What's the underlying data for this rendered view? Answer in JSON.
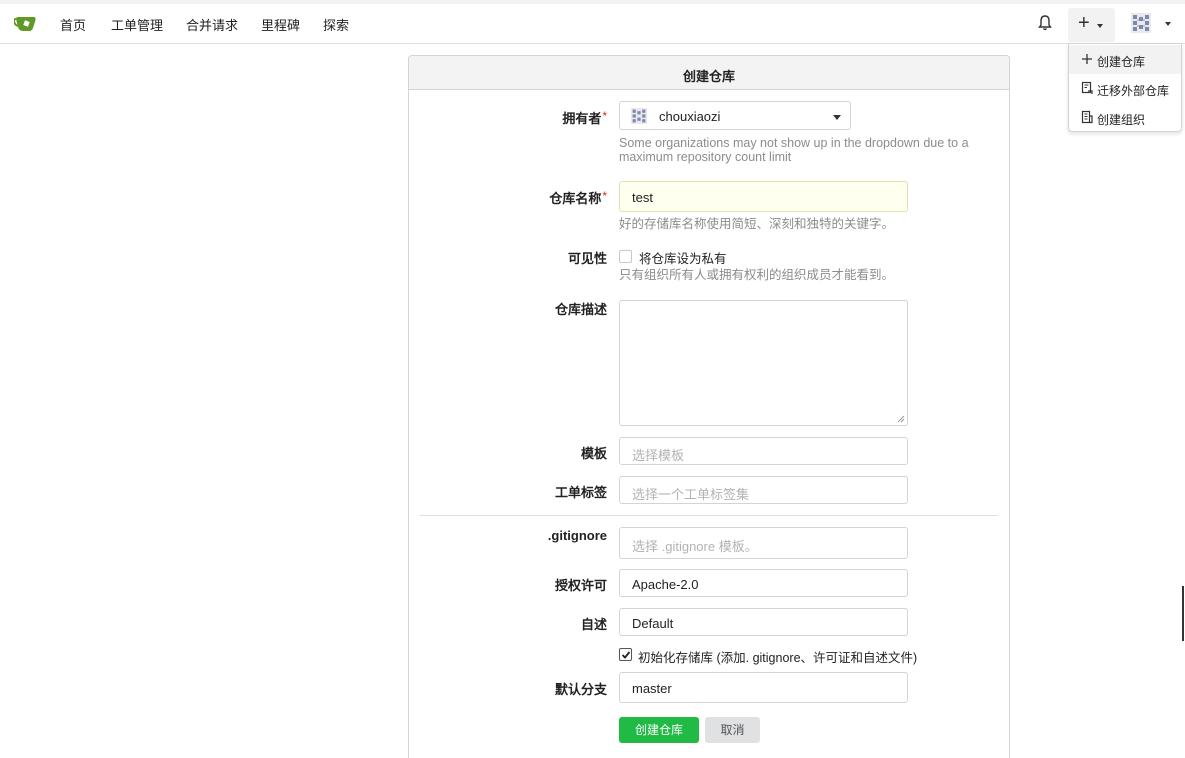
{
  "nav": {
    "items": [
      "首页",
      "工单管理",
      "合并请求",
      "里程碑",
      "探索"
    ],
    "bell_icon": "bell-icon",
    "plus_icon": "plus-icon",
    "avatar_icon": "user-avatar-icon"
  },
  "dropdown": {
    "items": [
      {
        "label": "创建仓库",
        "icon": "plus-icon"
      },
      {
        "label": "迁移外部仓库",
        "icon": "repo-clone-icon"
      },
      {
        "label": "创建组织",
        "icon": "organization-icon"
      }
    ]
  },
  "form": {
    "title": "创建仓库",
    "owner": {
      "label": "拥有者",
      "value": "chouxiaozi",
      "hint": "Some organizations may not show up in the dropdown due to a maximum repository count limit"
    },
    "repo_name": {
      "label": "仓库名称",
      "value": "test",
      "hint": "好的存储库名称使用简短、深刻和独特的关键字。"
    },
    "visibility": {
      "label": "可见性",
      "checkbox_label": "将仓库设为私有",
      "checked": false,
      "hint": "只有组织所有人或拥有权利的组织成员才能看到。"
    },
    "description": {
      "label": "仓库描述",
      "value": ""
    },
    "template": {
      "label": "模板",
      "placeholder": "选择模板"
    },
    "issue_labels": {
      "label": "工单标签",
      "placeholder": "选择一个工单标签集"
    },
    "gitignore": {
      "label": ".gitignore",
      "placeholder": "选择 .gitignore 模板。"
    },
    "license": {
      "label": "授权许可",
      "value": "Apache-2.0"
    },
    "readme": {
      "label": "自述",
      "value": "Default"
    },
    "auto_init": {
      "label": "初始化存储库 (添加. gitignore、许可证和自述文件)",
      "checked": true
    },
    "default_branch": {
      "label": "默认分支",
      "value": "master"
    },
    "submit_label": "创建仓库",
    "cancel_label": "取消"
  },
  "colors": {
    "primary": "#21ba45",
    "required": "#db2828",
    "highlight_input": "#fffff0",
    "logo": "#609926"
  }
}
